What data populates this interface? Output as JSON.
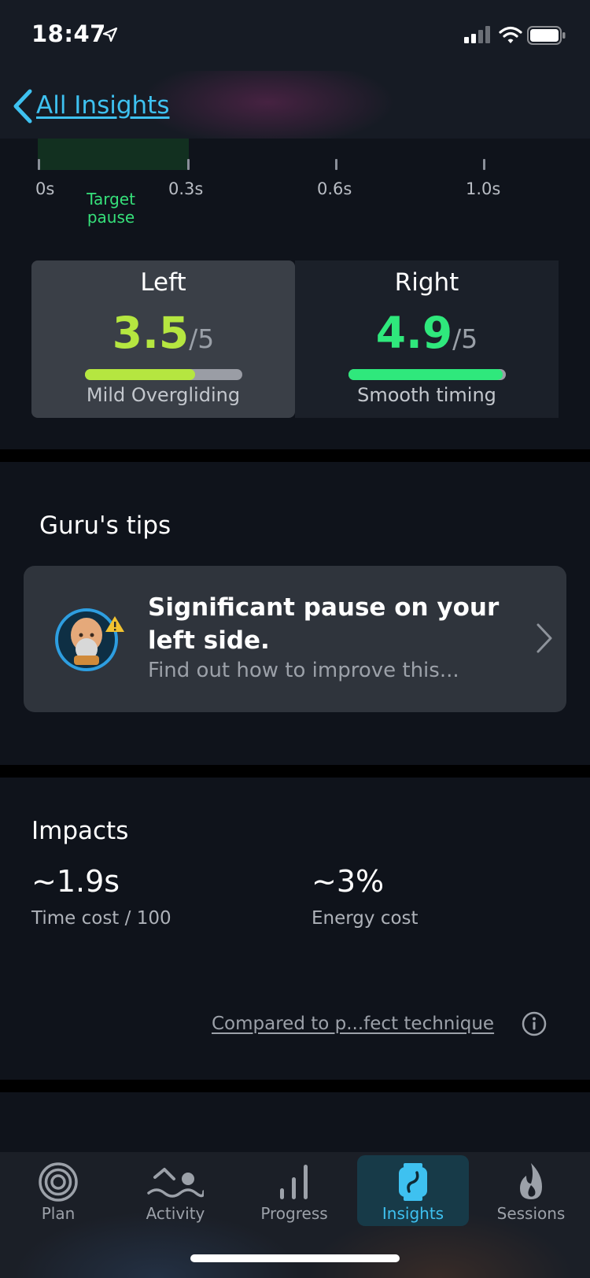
{
  "status_bar": {
    "time": "18:47",
    "icons": [
      "location-arrow-icon",
      "cellular-signal-icon",
      "wifi-icon",
      "battery-icon"
    ]
  },
  "nav": {
    "back_label": "All Insights"
  },
  "timing_scale": {
    "ticks": [
      "0s",
      "0.3s",
      "0.6s",
      "1.0s"
    ],
    "target_label": "Target pause"
  },
  "sides": {
    "left": {
      "title": "Left",
      "score": "3.5",
      "denominator": "/5",
      "fraction": 0.7,
      "label": "Mild Overgliding",
      "color": "#b5e640"
    },
    "right": {
      "title": "Right",
      "score": "4.9",
      "denominator": "/5",
      "fraction": 0.98,
      "label": "Smooth timing",
      "color": "#2fe87c"
    }
  },
  "tips": {
    "title": "Guru's tips",
    "card": {
      "title": "Significant pause on your left side.",
      "subtitle": "Find out how to improve this..."
    }
  },
  "impacts": {
    "title": "Impacts",
    "time_value": "~1.9s",
    "time_label": "Time cost / 100",
    "energy_value": "~3%",
    "energy_label": "Energy cost",
    "compare_link": "Compared to p...fect technique"
  },
  "tabs": [
    {
      "label": "Plan",
      "icon": "target-rings-icon",
      "active": false
    },
    {
      "label": "Activity",
      "icon": "swimmer-icon",
      "active": false
    },
    {
      "label": "Progress",
      "icon": "bar-chart-icon",
      "active": false
    },
    {
      "label": "Insights",
      "icon": "watch-insights-icon",
      "active": true
    },
    {
      "label": "Sessions",
      "icon": "flame-icon",
      "active": false
    }
  ],
  "colors": {
    "accent": "#3ec1f0",
    "good": "#2fe87c",
    "mild": "#b5e640"
  }
}
